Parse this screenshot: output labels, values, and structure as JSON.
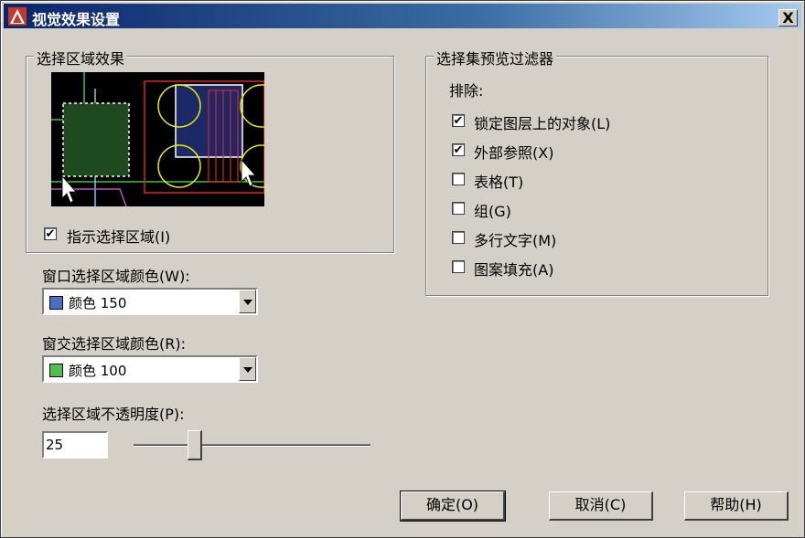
{
  "window": {
    "title": "视觉效果设置",
    "close_label": "X"
  },
  "selection_area_effect": {
    "title": "选择区域效果",
    "indicate_checkbox": {
      "label": "指示选择区域(I)",
      "checked": true
    }
  },
  "window_color": {
    "label": "窗口选择区域颜色(W):",
    "value": "颜色 150",
    "swatch_color": "#4a6ec5"
  },
  "crossing_color": {
    "label": "窗交选择区域颜色(R):",
    "value": "颜色 100",
    "swatch_color": "#4cc24c"
  },
  "opacity": {
    "label": "选择区域不透明度(P):",
    "value": "25"
  },
  "filter": {
    "title": "选择集预览过滤器",
    "exclude_label": "排除:",
    "items": [
      {
        "label": "锁定图层上的对象(L)",
        "checked": true
      },
      {
        "label": "外部参照(X)",
        "checked": true
      },
      {
        "label": "表格(T)",
        "checked": false
      },
      {
        "label": "组(G)",
        "checked": false
      },
      {
        "label": "多行文字(M)",
        "checked": false
      },
      {
        "label": "图案填充(A)",
        "checked": false
      }
    ]
  },
  "buttons": {
    "ok": "确定(O)",
    "cancel": "取消(C)",
    "help": "帮助(H)"
  },
  "check_mark": "✔"
}
